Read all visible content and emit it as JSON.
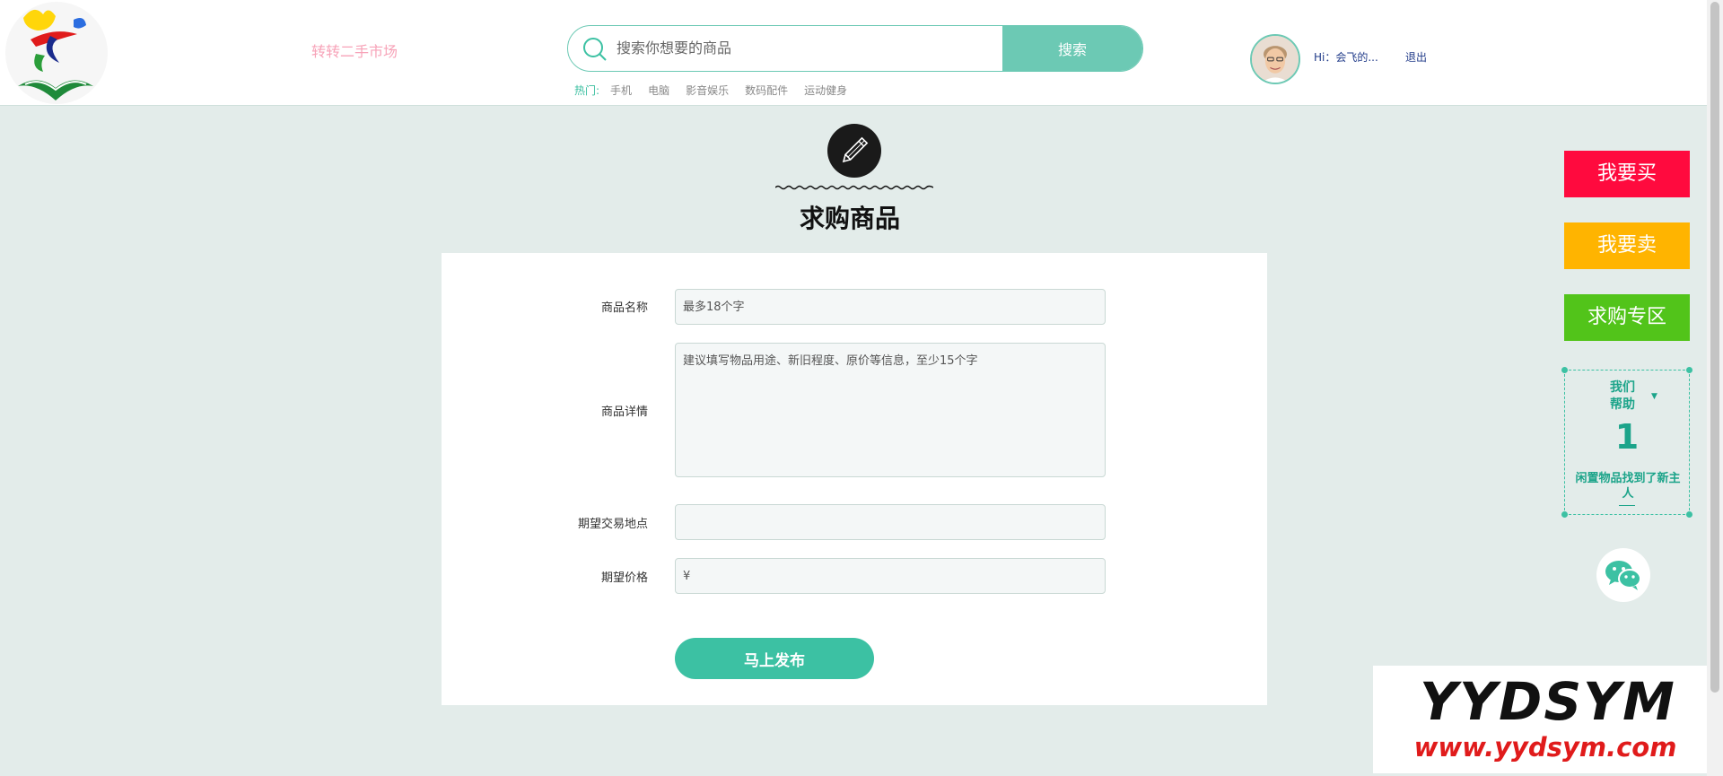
{
  "header": {
    "site_name": "转转二手市场",
    "search": {
      "placeholder": "搜索你想要的商品",
      "button_label": "搜索"
    },
    "hot": {
      "label": "热门:",
      "links": [
        "手机",
        "电脑",
        "影音娱乐",
        "数码配件",
        "运动健身"
      ]
    },
    "user": {
      "greeting": "Hi：会飞的...",
      "logout_label": "退出"
    }
  },
  "page": {
    "title": "求购商品"
  },
  "form": {
    "fields": [
      {
        "label": "商品名称",
        "placeholder": "最多18个字",
        "value": ""
      },
      {
        "label": "商品详情",
        "placeholder": "建议填写物品用途、新旧程度、原价等信息，至少15个字",
        "value": ""
      },
      {
        "label": "期望交易地点",
        "placeholder": "",
        "value": ""
      },
      {
        "label": "期望价格",
        "placeholder": "¥",
        "value": ""
      }
    ],
    "submit_label": "马上发布"
  },
  "sidebar": {
    "buttons": [
      {
        "label": "我要买",
        "color": "#ff0a3e"
      },
      {
        "label": "我要卖",
        "color": "#ffb400"
      },
      {
        "label": "求购专区",
        "color": "#52c41a"
      }
    ],
    "help": {
      "title_line1": "我们",
      "title_line2": "帮助",
      "number": "1",
      "text": "闲置物品找到了新主人"
    }
  },
  "watermark": {
    "brand": "YYDSYM",
    "url": "www.yydsym.com"
  },
  "colors": {
    "accent": "#3cc1a3",
    "page_background": "#e3ecea",
    "site_name": "#f7a3b8"
  },
  "icons": {
    "logo": "flower-book-logo",
    "search": "search-icon",
    "title": "pencil-icon",
    "wechat": "wechat-icon"
  }
}
